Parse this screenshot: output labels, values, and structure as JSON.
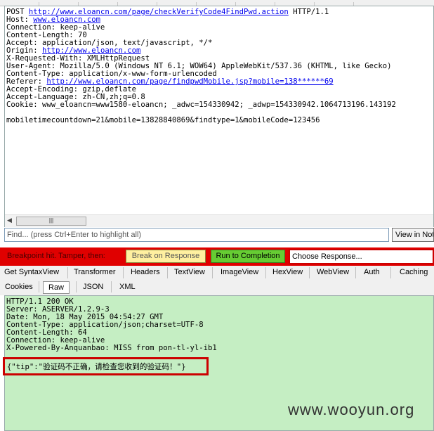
{
  "request": {
    "line1_prefix": "POST ",
    "line1_url": "http://www.eloancn.com/page/checkVerifyCode4FindPwd.action",
    "line1_suffix": " HTTP/1.1",
    "host_prefix": "Host: ",
    "host_url": "www.eloancn.com",
    "connection": "Connection: keep-alive",
    "content_length": "Content-Length: 70",
    "accept": "Accept: application/json, text/javascript, */*",
    "origin_prefix": "Origin: ",
    "origin_url": "http://www.eloancn.com",
    "x_requested": "X-Requested-With: XMLHttpRequest",
    "user_agent": "User-Agent: Mozilla/5.0 (Windows NT 6.1; WOW64) AppleWebKit/537.36 (KHTML, like Gecko)",
    "content_type": "Content-Type: application/x-www-form-urlencoded",
    "referer_prefix": "Referer: ",
    "referer_url": "http://www.eloancn.com/page/findpwdMobile.jsp?mobile=138******69",
    "accept_encoding": "Accept-Encoding: gzip,deflate",
    "accept_language": "Accept-Language: zh-CN,zh;q=0.8",
    "cookie": "Cookie: www_eloancn=www1580-eloancn; _adwc=154330942; _adwp=154330942.1064713196.143192",
    "body": "mobiletimecountdown=21&mobile=13828840869&findtype=1&mobileCode=123456"
  },
  "scroll_thumb": "|||",
  "find": {
    "placeholder": "Find... (press Ctrl+Enter to highlight all)",
    "view_button": "View in Not"
  },
  "breakpoint": {
    "message": "Breakpoint hit. Tamper, then:",
    "break_on_response": "Break on Response",
    "run_to_completion": "Run to Completion",
    "choose_response": "Choose Response..."
  },
  "response_tabs_row1": [
    "Get SyntaxView",
    "Transformer",
    "Headers",
    "TextView",
    "ImageView",
    "HexView",
    "WebView",
    "Auth",
    "Caching"
  ],
  "response_tabs_row2": [
    "Cookies",
    "Raw",
    "JSON",
    "XML"
  ],
  "response": {
    "status": "HTTP/1.1 200 OK",
    "server": "Server: ASERVER/1.2.9-3",
    "date": "Date: Mon, 18 May 2015 04:54:27 GMT",
    "content_type": "Content-Type: application/json;charset=UTF-8",
    "content_length": "Content-Length: 64",
    "connection": "Connection: keep-alive",
    "powered": "X-Powered-By-Anquanbao: MISS from pon-tl-yl-ib1",
    "body": "{\"tip\":\"验证码不正确，请检查您收到的验证码！\"}"
  },
  "watermark": "www.wooyun.org",
  "colors": {
    "breakpoint_bar": "#e00000",
    "response_bg": "#c5eec3",
    "highlight": "#cc0000"
  }
}
